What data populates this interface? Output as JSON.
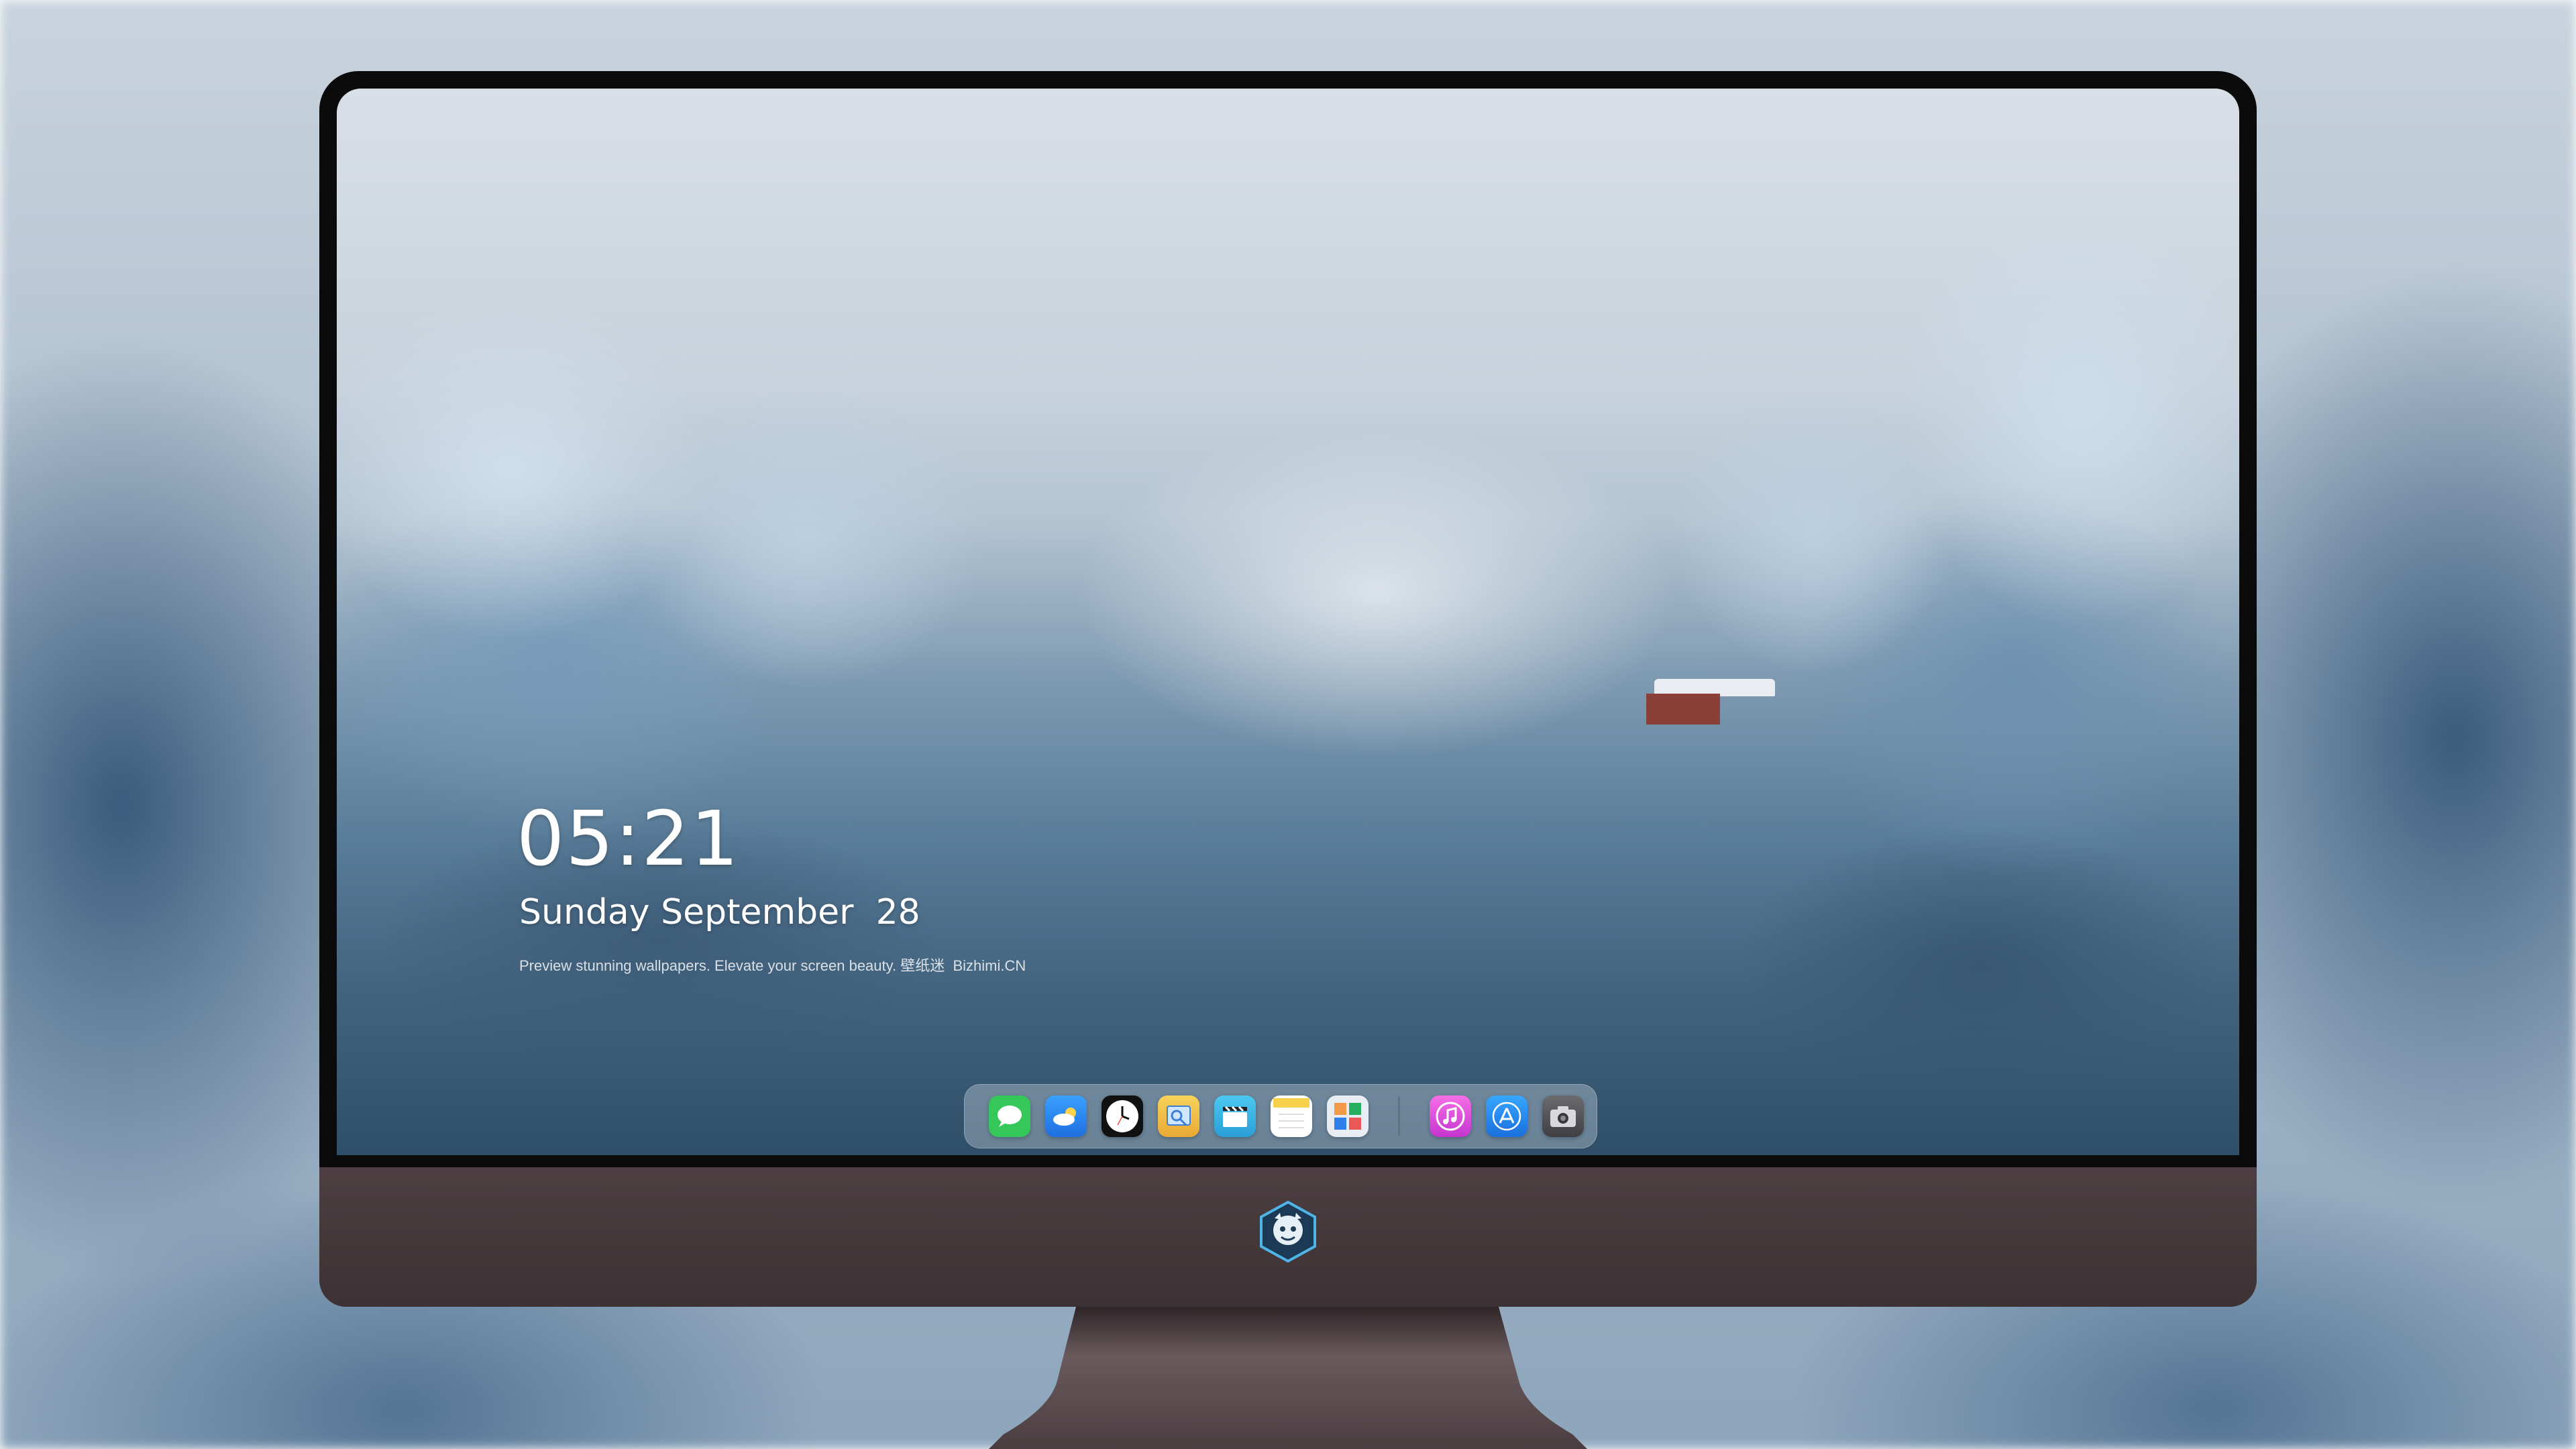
{
  "lock_screen": {
    "time": "05:21",
    "date": "Sunday September  28",
    "tagline": "Preview stunning wallpapers. Elevate your screen beauty. 壁纸迷  Bizhimi.CN"
  },
  "dock": {
    "apps": [
      {
        "name": "Messages",
        "icon": "messages-icon",
        "color": "#35c759"
      },
      {
        "name": "Weather",
        "icon": "weather-icon",
        "color": "#2f8ff5"
      },
      {
        "name": "Clock",
        "icon": "clock-icon",
        "color": "#111111"
      },
      {
        "name": "Preview",
        "icon": "preview-icon",
        "color": "#f2c94c"
      },
      {
        "name": "Final Cut",
        "icon": "clapper-icon",
        "color": "#38b8e6"
      },
      {
        "name": "Notes",
        "icon": "notes-icon",
        "color": "#f7d14c"
      },
      {
        "name": "Photo Booth",
        "icon": "photos-grid-icon",
        "color": "#e8edf3"
      },
      {
        "name": "iTunes",
        "icon": "music-icon",
        "color": "#e04fd8"
      },
      {
        "name": "App Store",
        "icon": "app-store-icon",
        "color": "#2a8df0"
      },
      {
        "name": "Camera",
        "icon": "camera-icon",
        "color": "#5b5b5f"
      }
    ]
  },
  "colors": {
    "chin": "#4d3f42",
    "bezel": "#0b0b0c"
  }
}
